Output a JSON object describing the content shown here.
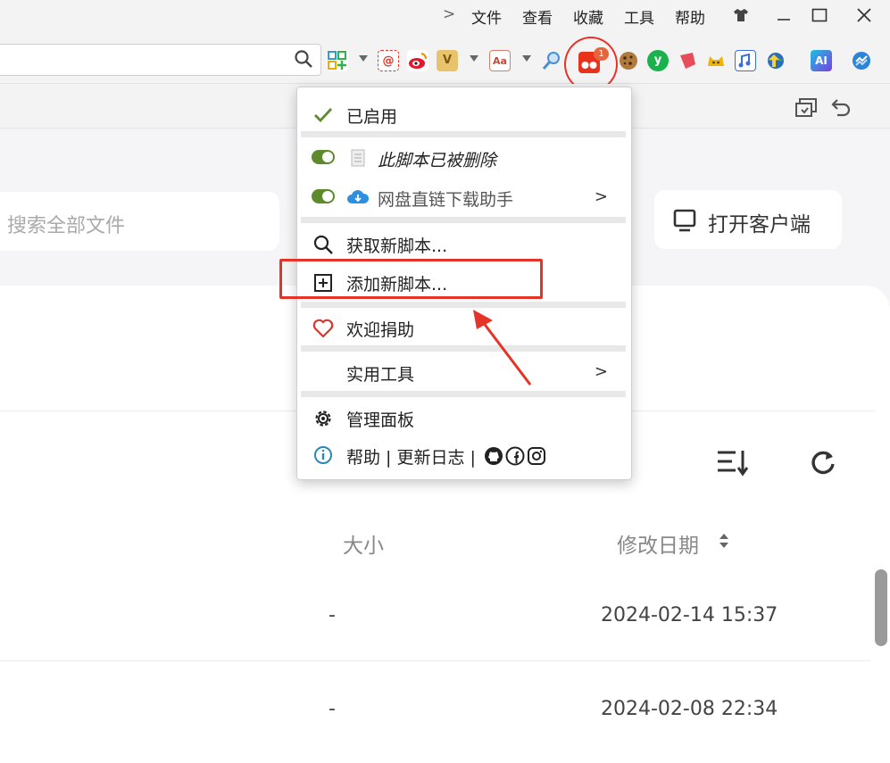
{
  "menubar": {
    "chevron": ">",
    "items": [
      "文件",
      "查看",
      "收藏",
      "工具",
      "帮助"
    ],
    "window_controls": [
      "minimize",
      "maximize",
      "close"
    ]
  },
  "toolbar": {
    "address_value": "",
    "extensions": [
      {
        "icon": "apps-grid-icon",
        "color": "#2d9cdb"
      },
      {
        "icon": "email-icon",
        "color": "#e53327"
      },
      {
        "icon": "weibo-icon",
        "color": "#e6162d"
      },
      {
        "icon": "image-tool-icon",
        "color": "#e2a31c"
      },
      {
        "icon": "dictionary-icon",
        "color": "#e07b6c"
      },
      {
        "icon": "magnifier-icon",
        "color": "#4a8fd4"
      },
      {
        "icon": "tampermonkey-icon",
        "color": "#e8321c"
      },
      {
        "icon": "cookie-icon",
        "color": "#8b5a2b"
      },
      {
        "icon": "yandex-icon",
        "color": "#1bb14d"
      },
      {
        "icon": "shape-icon",
        "color": "#e84b5a"
      },
      {
        "icon": "cat-icon",
        "color": "#f0b400"
      },
      {
        "icon": "puzzle-icon",
        "color": "#3a6fd8"
      },
      {
        "icon": "idm-icon",
        "color": "#2a8f4a"
      },
      {
        "icon": "ai-icon",
        "color": "#2f7de1"
      },
      {
        "icon": "sync-icon",
        "color": "#2a84d8"
      }
    ],
    "badge_count": "1"
  },
  "dropdown": {
    "enabled_label": "已启用",
    "scripts": [
      {
        "name": "此脚本已被删除",
        "italic": true
      },
      {
        "name": "网盘直链下载助手",
        "chevron": ">"
      }
    ],
    "get_new_label": "获取新脚本...",
    "add_new_label": "添加新脚本...",
    "donate_label": "欢迎捐助",
    "tools_label": "实用工具",
    "tools_chevron": ">",
    "dashboard_label": "管理面板",
    "help_label": "帮助 | 更新日志 |"
  },
  "page": {
    "search_placeholder": "搜索全部文件",
    "open_client_label": "打开客户端",
    "columns": {
      "size": "大小",
      "modified": "修改日期"
    },
    "rows": [
      {
        "size": "-",
        "modified": "2024-02-14 15:37"
      },
      {
        "size": "-",
        "modified": "2024-02-08 22:34"
      }
    ]
  }
}
